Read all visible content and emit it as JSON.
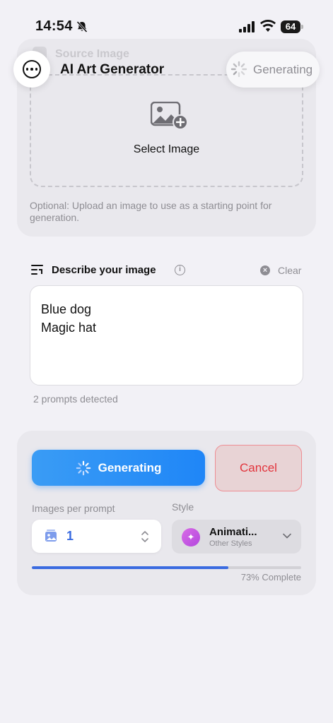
{
  "status_bar": {
    "time": "14:54",
    "battery": "64"
  },
  "header": {
    "title": "AI Art Generator",
    "status_pill": "Generating",
    "menu_icon": "ellipsis-circle-icon"
  },
  "source_image": {
    "title": "Source Image",
    "select_label": "Select Image",
    "hint": "Optional: Upload an image to use as a starting point for generation."
  },
  "describe": {
    "title": "Describe your image",
    "clear_label": "Clear",
    "prompt_text": "Blue dog\nMagic hat",
    "prompt_count": "2 prompts detected"
  },
  "generate": {
    "button_label": "Generating",
    "cancel_label": "Cancel",
    "images_per_prompt_label": "Images per prompt",
    "images_per_prompt_value": "1",
    "style_label": "Style",
    "style_name": "Animati...",
    "style_category": "Other Styles",
    "progress_percent": 73,
    "progress_text": "73% Complete"
  },
  "colors": {
    "accent_blue": "#1f86f7",
    "progress_blue": "#3a6be0",
    "cancel_red": "#e2343c",
    "style_purple": "#c65ae2"
  }
}
